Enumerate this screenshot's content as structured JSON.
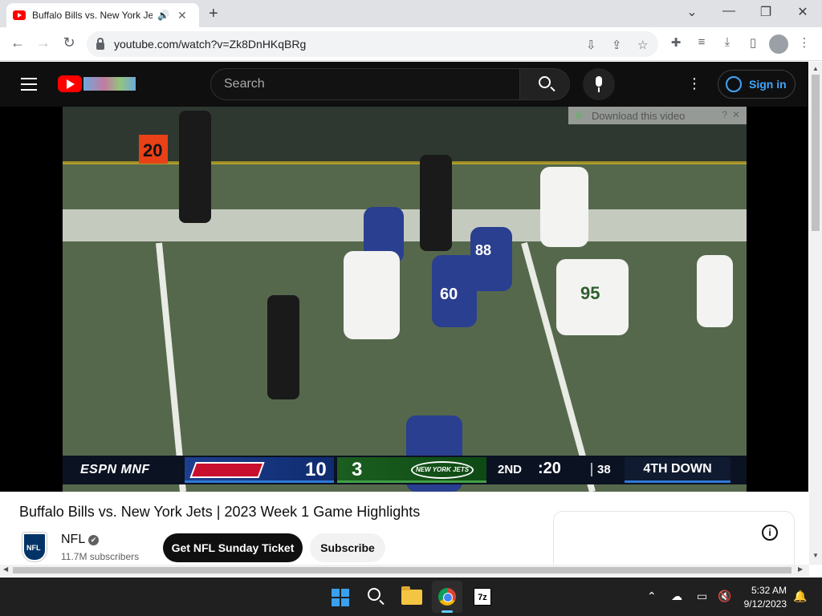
{
  "browser": {
    "tab_title": "Buffalo Bills vs. New York Jets",
    "audio_icon": "speaker-icon",
    "close_glyph": "✕",
    "newtab_glyph": "+",
    "url": "youtube.com/watch?v=Zk8DnHKqBRg",
    "window_controls": [
      "⌄",
      "—",
      "❐",
      "✕"
    ]
  },
  "youtube": {
    "search_placeholder": "Search",
    "signin_label": "Sign in",
    "download_badge": "Download this video",
    "download_help": "?",
    "download_close": "✕"
  },
  "scoreboard": {
    "network": "ESPN MNF",
    "home_team": "Bills",
    "home_score": "10",
    "away_team": "Jets",
    "away_logo_text": "NEW YORK JETS",
    "away_score": "3",
    "quarter": "2ND",
    "game_clock": ":20",
    "play_clock": "38",
    "down": "4TH DOWN"
  },
  "video": {
    "title": "Buffalo Bills vs. New York Jets | 2023 Week 1 Game Highlights",
    "channel_name": "NFL",
    "verified_glyph": "✔",
    "subscribers": "11.7M subscribers",
    "ticket_button": "Get NFL Sunday Ticket",
    "subscribe_button": "Subscribe",
    "info_glyph": "i"
  },
  "taskbar": {
    "app_7z_label": "7z",
    "time": "5:32 AM",
    "date": "9/12/2023",
    "tray_chevron": "⌃"
  },
  "colors": {
    "youtube_red": "#ff0000",
    "signin_blue": "#3ea6ff",
    "bills_blue": "#1d3f8f",
    "jets_green": "#1b5e20"
  }
}
